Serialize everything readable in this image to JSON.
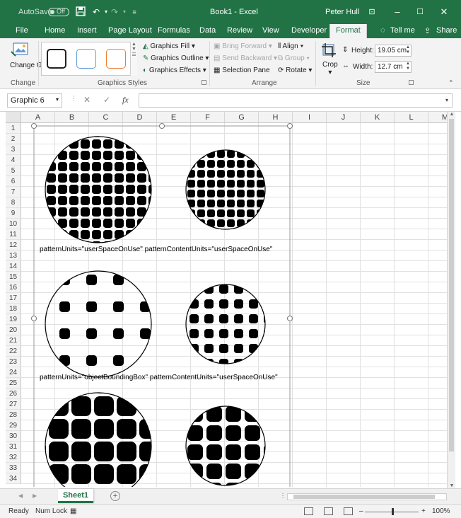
{
  "titlebar": {
    "autosave_label": "AutoSave",
    "autosave_state": "Off",
    "doc_title": "Book1 - Excel",
    "user": "Peter Hull",
    "save_icon": "save-icon",
    "undo_icon": "undo-icon",
    "redo_icon": "redo-icon"
  },
  "tabs": [
    "File",
    "Home",
    "Insert",
    "Page Layout",
    "Formulas",
    "Data",
    "Review",
    "View",
    "Developer",
    "Format"
  ],
  "active_tab": "Format",
  "tell_me": "Tell me",
  "share": "Share",
  "ribbon": {
    "change_graphic": "Change Graphic",
    "change_group": "Change",
    "graphics_styles_group": "Graphics Styles",
    "graphics_fill": "Graphics Fill",
    "graphics_outline": "Graphics Outline",
    "graphics_effects": "Graphics Effects",
    "bring_forward": "Bring Forward",
    "send_backward": "Send Backward",
    "selection_pane": "Selection Pane",
    "align": "Align",
    "group": "Group",
    "rotate": "Rotate",
    "arrange_group": "Arrange",
    "crop": "Crop",
    "height_label": "Height:",
    "height_value": "19.05 cm",
    "width_label": "Width:",
    "width_value": "12.7 cm",
    "size_group": "Size",
    "style_colors": [
      "#222222",
      "#5b9bd5",
      "#ed7d31"
    ]
  },
  "formula_bar": {
    "name_box": "Graphic 6",
    "fx": "fx",
    "value": ""
  },
  "columns": [
    "A",
    "B",
    "C",
    "D",
    "E",
    "F",
    "G",
    "H",
    "I",
    "J",
    "K",
    "L",
    "M"
  ],
  "rows": [
    "1",
    "2",
    "3",
    "4",
    "5",
    "6",
    "7",
    "8",
    "9",
    "10",
    "11",
    "12",
    "13",
    "14",
    "15",
    "16",
    "17",
    "18",
    "19",
    "20",
    "21",
    "22",
    "23",
    "24",
    "25",
    "26",
    "27",
    "28",
    "29",
    "30",
    "31",
    "32",
    "33",
    "34"
  ],
  "captions": {
    "first": "patternUnits=\"userSpaceOnUse\" patternContentUnits=\"userSpaceOnUse\"",
    "second": "patternUnits=\"objectBoundingBox\" patternContentUnits=\"userSpaceOnUse\""
  },
  "sheet_tab": "Sheet1",
  "status": {
    "ready": "Ready",
    "num_lock": "Num Lock",
    "zoom": "100%"
  }
}
